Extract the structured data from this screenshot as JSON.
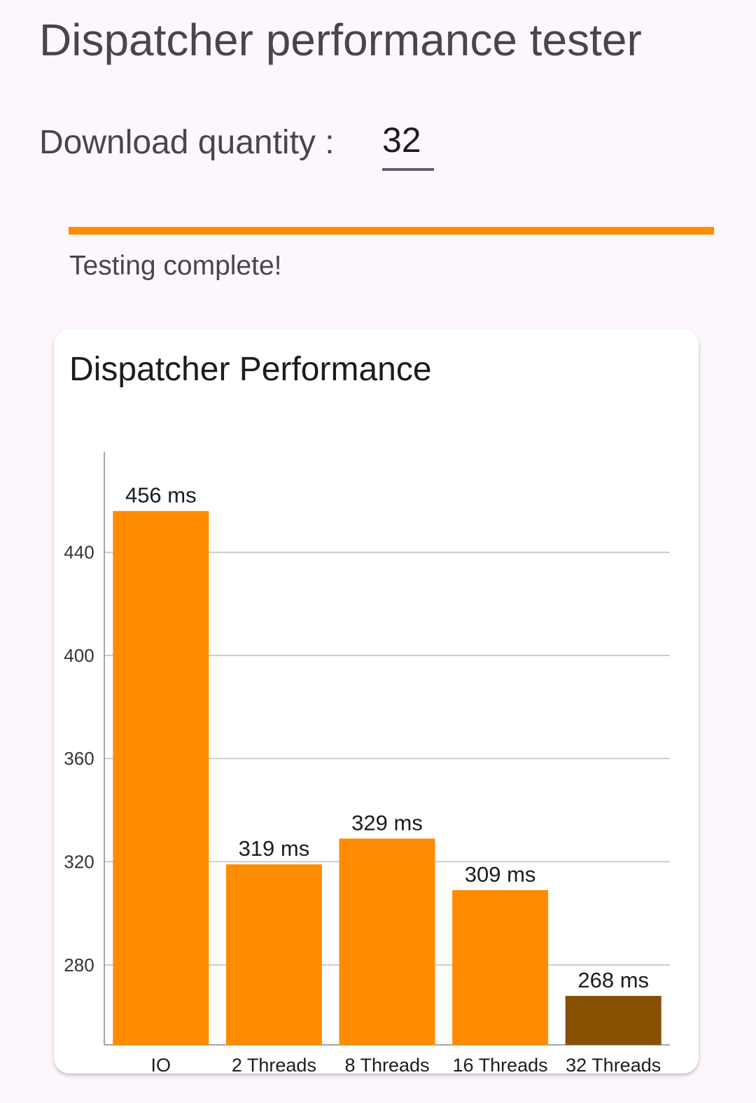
{
  "app": {
    "title": "Dispatcher performance tester"
  },
  "form": {
    "quantity_label": "Download quantity :",
    "quantity_value": "32"
  },
  "progress": {
    "value": 1.0,
    "status_text": "Testing complete!"
  },
  "card": {
    "title": "Dispatcher Performance"
  },
  "colors": {
    "bar": "#ff8c00",
    "bar_highlight": "#874f00",
    "grid": "#bdbdbd",
    "axis": "#888888"
  },
  "chart_data": {
    "type": "bar",
    "title": "Dispatcher Performance",
    "categories": [
      "IO",
      "2 Threads",
      "8 Threads",
      "16 Threads",
      "32 Threads"
    ],
    "values": [
      456,
      319,
      329,
      309,
      268
    ],
    "value_labels": [
      "456 ms",
      "319 ms",
      "329 ms",
      "309 ms",
      "268 ms"
    ],
    "highlight_index": 4,
    "ylim": [
      249,
      479
    ],
    "yticks": [
      280,
      320,
      360,
      400,
      440
    ],
    "grid": true,
    "xlabel": "",
    "ylabel": ""
  }
}
